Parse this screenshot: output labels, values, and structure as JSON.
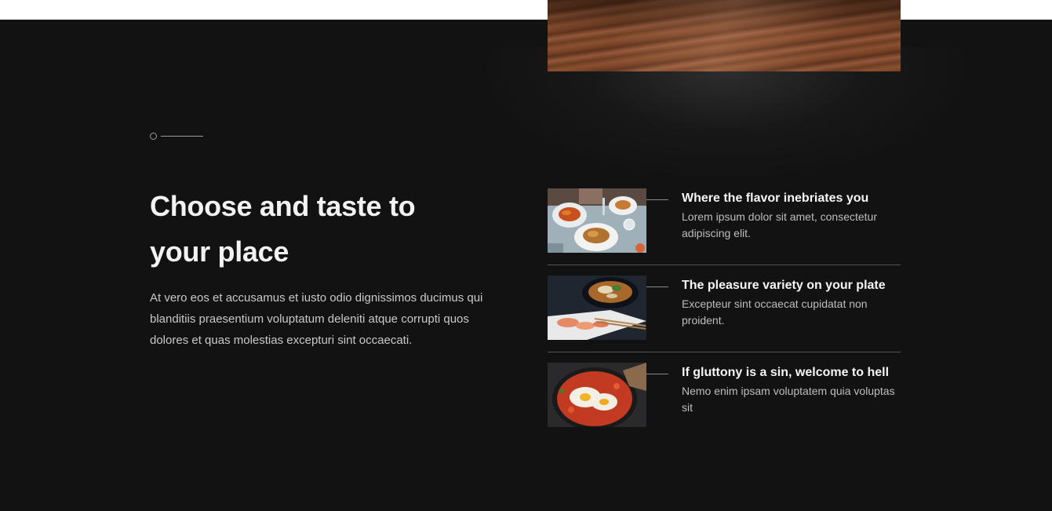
{
  "section": {
    "heading_line1": "Choose and taste to",
    "heading_line2": "your place",
    "intro": "At vero eos et accusamus et iusto odio dignissimos ducimus qui blanditiis praesentium voluptatum deleniti atque corrupti quos dolores et quas molestias excepturi sint occaecati."
  },
  "features": [
    {
      "title": "Where the flavor inebriates you",
      "description": "Lorem ipsum dolor sit amet, consectetur adipiscing elit.",
      "image": "restaurant-table-dishes"
    },
    {
      "title": "The pleasure variety on your plate",
      "description": "Excepteur sint occaecat cupidatat non proident.",
      "image": "ramen-and-sushi-plate"
    },
    {
      "title": "If gluttony is a sin, welcome to hell",
      "description": "Nemo enim ipsam voluptatem quia voluptas sit",
      "image": "shakshuka-pan"
    }
  ],
  "colors": {
    "background": "#121212",
    "top_strip": "#ffffff",
    "heading": "#f2f2f2",
    "body_text": "#c9c9c9",
    "divider": "#555555"
  }
}
